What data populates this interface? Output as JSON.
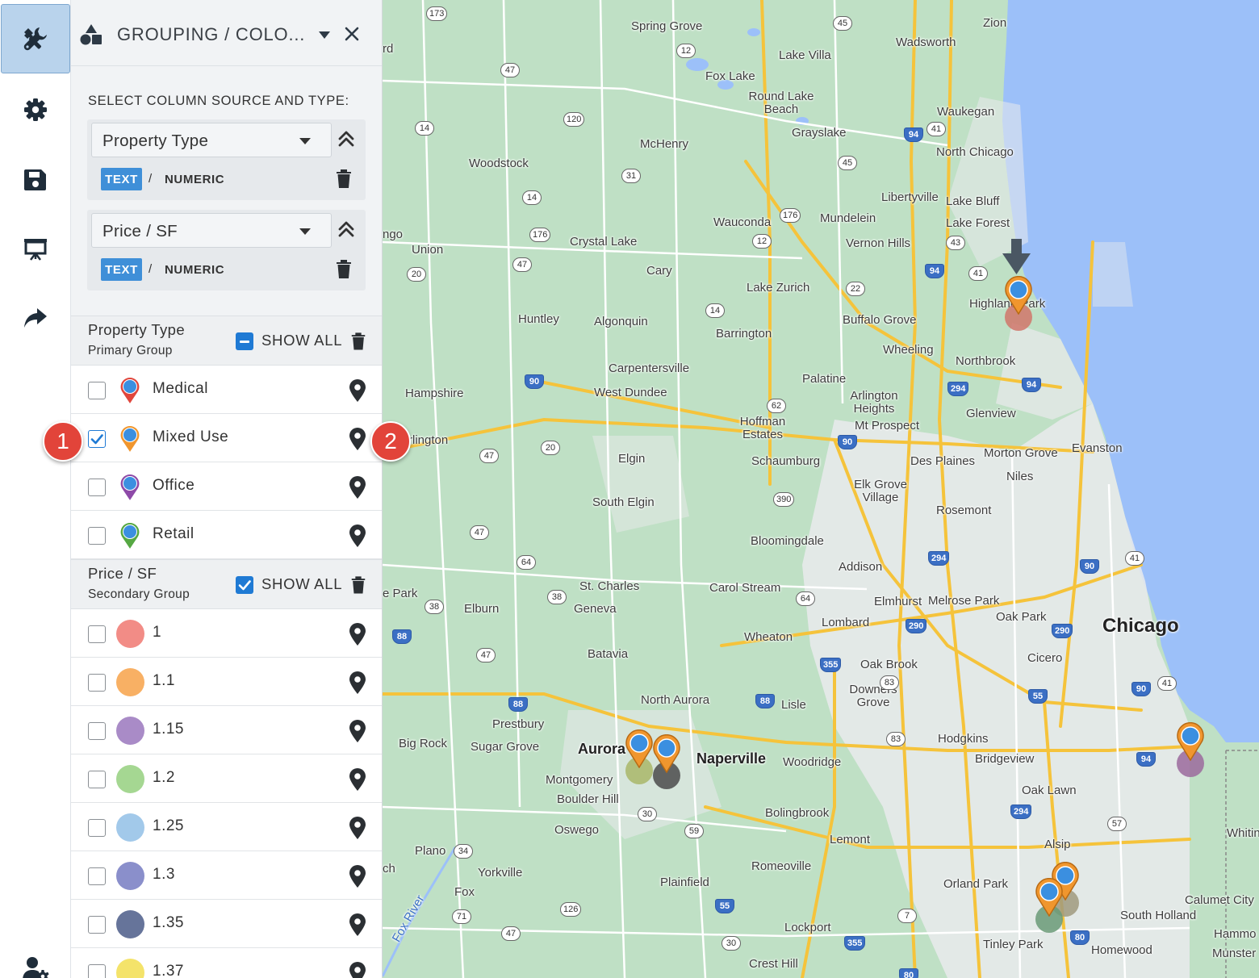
{
  "toolbar": {
    "items": [
      {
        "name": "tools-icon",
        "active": true
      },
      {
        "name": "gear-icon",
        "active": false
      },
      {
        "name": "save-icon",
        "active": false
      },
      {
        "name": "presentation-icon",
        "active": false
      },
      {
        "name": "share-icon",
        "active": false
      },
      {
        "name": "user-settings-icon",
        "active": false
      }
    ]
  },
  "panel": {
    "title": "GROUPING / COLO...",
    "source_label": "SELECT COLUMN SOURCE AND TYPE:",
    "sources": [
      {
        "column": "Property Type",
        "type_text": "TEXT",
        "type_sep": "/",
        "type_numeric": "NUMERIC",
        "selected_type": "TEXT"
      },
      {
        "column": "Price / SF",
        "type_text": "TEXT",
        "type_sep": "/",
        "type_numeric": "NUMERIC",
        "selected_type": "TEXT"
      }
    ],
    "groups": [
      {
        "title": "Property Type",
        "subtitle": "Primary Group",
        "show_all_label": "SHOW ALL",
        "show_all_state": "indeterminate",
        "items": [
          {
            "label": "Medical",
            "checked": false,
            "marker_color": "#e0463c"
          },
          {
            "label": "Mixed Use",
            "checked": true,
            "marker_color": "#f0962e"
          },
          {
            "label": "Office",
            "checked": false,
            "marker_color": "#8e4aa8"
          },
          {
            "label": "Retail",
            "checked": false,
            "marker_color": "#56a843"
          }
        ]
      },
      {
        "title": "Price / SF",
        "subtitle": "Secondary Group",
        "show_all_label": "SHOW ALL",
        "show_all_state": "checked",
        "items": [
          {
            "label": "1",
            "checked": false,
            "color": "#f28c86"
          },
          {
            "label": "1.1",
            "checked": false,
            "color": "#f8b064"
          },
          {
            "label": "1.15",
            "checked": false,
            "color": "#a98bc7"
          },
          {
            "label": "1.2",
            "checked": false,
            "color": "#a5d792"
          },
          {
            "label": "1.25",
            "checked": false,
            "color": "#a2c9ea"
          },
          {
            "label": "1.3",
            "checked": false,
            "color": "#8a8fcb"
          },
          {
            "label": "1.35",
            "checked": false,
            "color": "#66749a"
          },
          {
            "label": "1.37",
            "checked": false,
            "color": "#f4e36a"
          }
        ]
      }
    ]
  },
  "callouts": [
    "1",
    "2"
  ],
  "map": {
    "places": [
      "Spring Grove",
      "Zion",
      "Wadsworth",
      "Lake Villa",
      "Fox Lake",
      "Round Lake Beach",
      "Waukegan",
      "Grayslake",
      "McHenry",
      "North Chicago",
      "Woodstock",
      "Libertyville",
      "Lake Bluff",
      "Lake Forest",
      "Wauconda",
      "Mundelein",
      "Crystal Lake",
      "Vernon Hills",
      "Union",
      "Cary",
      "Lake Zurich",
      "Highland Park",
      "Huntley",
      "Algonquin",
      "Barrington",
      "Buffalo Grove",
      "Wheeling",
      "Northbrook",
      "Carpentersville",
      "Palatine",
      "Hampshire",
      "West Dundee",
      "Arlington Heights",
      "Glenview",
      "Hoffman Estates",
      "Mt Prospect",
      "Evanston",
      "Morton Grove",
      "Elgin",
      "Schaumburg",
      "Des Plaines",
      "Niles",
      "Elk Grove Village",
      "South Elgin",
      "Rosemont",
      "Bloomingdale",
      "Addison",
      "St. Charles",
      "Carol Stream",
      "Elmhurst",
      "Melrose Park",
      "Elburn",
      "Geneva",
      "Oak Park",
      "Chicago",
      "Lombard",
      "Wheaton",
      "Batavia",
      "Oak Brook",
      "Cicero",
      "Downers Grove",
      "North Aurora",
      "Lisle",
      "Prestbury",
      "Big Rock",
      "Sugar Grove",
      "Aurora",
      "Naperville",
      "Woodridge",
      "Hodgkins",
      "Bridgeview",
      "Montgomery",
      "Oak Lawn",
      "Boulder Hill",
      "Bolingbrook",
      "Oswego",
      "Lemont",
      "Alsip",
      "Plano",
      "Yorkville",
      "Romeoville",
      "Plainfield",
      "Orland Park",
      "Calumet City",
      "Fox",
      "South Holland",
      "Lockport",
      "Tinley Park",
      "Homewood",
      "Crest Hill",
      "Hammo",
      "Munster",
      "Whitin",
      "rd",
      "ngo",
      "rlington",
      "e Park",
      "ch",
      "Fox River"
    ],
    "route_shields": [
      "173",
      "45",
      "12",
      "47",
      "41",
      "120",
      "14",
      "94",
      "45",
      "31",
      "14",
      "176",
      "176",
      "12",
      "43",
      "47",
      "20",
      "94",
      "41",
      "22",
      "14",
      "294",
      "94",
      "90",
      "62",
      "20",
      "47",
      "90",
      "390",
      "294",
      "47",
      "64",
      "38",
      "38",
      "41",
      "90",
      "64",
      "290",
      "290",
      "88",
      "355",
      "83",
      "47",
      "88",
      "88",
      "55",
      "90",
      "41",
      "83",
      "94",
      "294",
      "57",
      "30",
      "59",
      "34",
      "71",
      "126",
      "55",
      "7",
      "355",
      "80",
      "47",
      "30",
      "80"
    ]
  }
}
